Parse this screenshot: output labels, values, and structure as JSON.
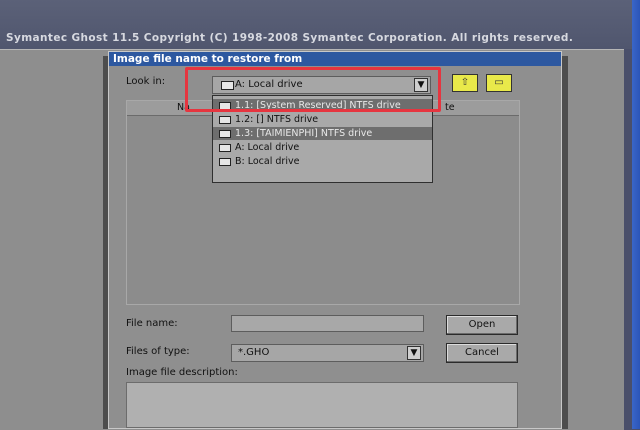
{
  "app": {
    "title_bar": "Symantec Ghost 11.5   Copyright (C) 1998-2008 Symantec Corporation. All rights reserved."
  },
  "dialog": {
    "title": "Image file name to restore from",
    "look_in_label": "Look in:",
    "look_in_value": "A: Local drive",
    "file_list": {
      "headers": [
        "Na",
        "te"
      ]
    },
    "drive_dropdown": {
      "items": [
        {
          "label": "1.1: [System Reserved] NTFS drive",
          "highlighted": true
        },
        {
          "label": "1.2: [] NTFS drive",
          "highlighted": false
        },
        {
          "label": "1.3: [TAIMIENPHI] NTFS drive",
          "highlighted": true
        },
        {
          "label": "A: Local drive",
          "highlighted": false
        },
        {
          "label": "B: Local drive",
          "highlighted": false
        }
      ]
    },
    "file_name_label": "File name:",
    "file_name_value": "",
    "files_of_type_label": "Files of type:",
    "files_of_type_value": "*.GHO",
    "open_button": "Open",
    "cancel_button": "Cancel",
    "description_label": "Image file description:",
    "description_value": ""
  },
  "colors": {
    "title_bar_blue": "#2d58a0",
    "dialog_grey": "#8f8f8f",
    "highlight_red": "#e6353f",
    "toolbar_yellow": "#e9e94a"
  },
  "icons": [
    "drive-icon",
    "up-folder-icon",
    "new-folder-icon",
    "dropdown-arrow-icon"
  ]
}
